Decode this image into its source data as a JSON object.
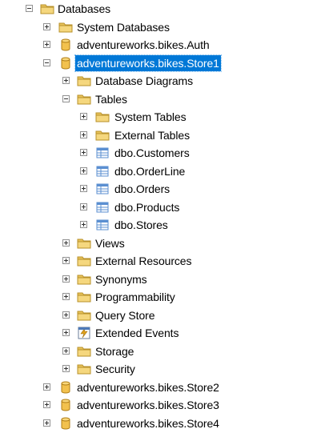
{
  "tree": {
    "databases": {
      "label": "Databases",
      "children": {
        "system_databases": "System Databases",
        "auth": "adventureworks.bikes.Auth",
        "store1": {
          "label": "adventureworks.bikes.Store1",
          "children": {
            "database_diagrams": "Database Diagrams",
            "tables": {
              "label": "Tables",
              "children": {
                "system_tables": "System Tables",
                "external_tables": "External Tables",
                "customers": "dbo.Customers",
                "orderline": "dbo.OrderLine",
                "orders": "dbo.Orders",
                "products": "dbo.Products",
                "stores": "dbo.Stores"
              }
            },
            "views": "Views",
            "external_resources": "External Resources",
            "synonyms": "Synonyms",
            "programmability": "Programmability",
            "query_store": "Query Store",
            "extended_events": "Extended Events",
            "storage": "Storage",
            "security": "Security"
          }
        },
        "store2": "adventureworks.bikes.Store2",
        "store3": "adventureworks.bikes.Store3",
        "store4": "adventureworks.bikes.Store4"
      }
    }
  },
  "colors": {
    "selection": "#0078d7",
    "folder": "#e8c25a",
    "database": "#f2c14e",
    "table": "#5b8fd1"
  },
  "icons": {
    "folder": "folder-icon",
    "database": "database-icon",
    "table": "table-icon",
    "extended_events": "extended-events-icon"
  }
}
